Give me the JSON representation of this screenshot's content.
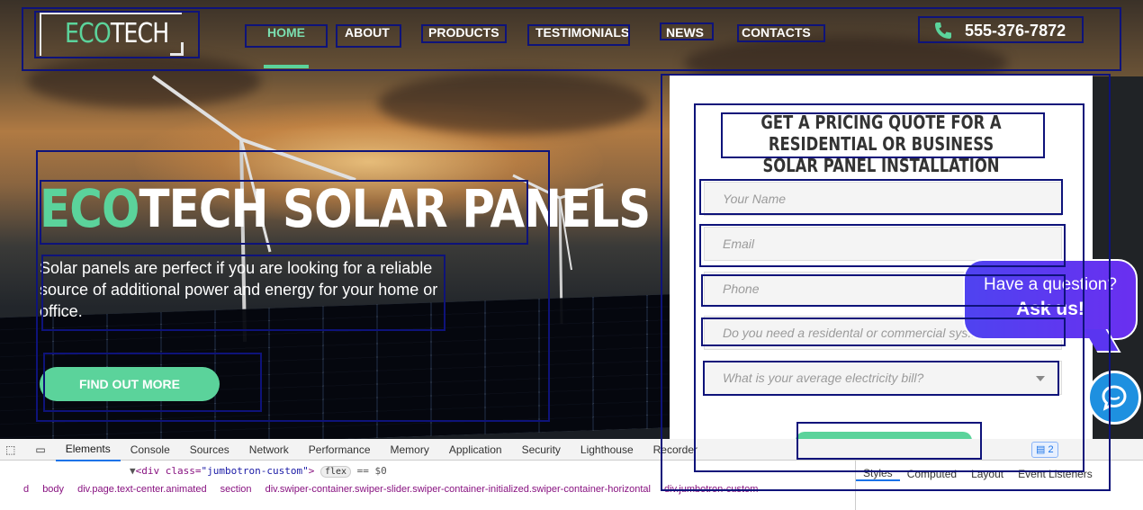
{
  "brand": {
    "eco": "ECO",
    "tech": "TECH"
  },
  "nav": {
    "items": [
      {
        "label": "HOME",
        "active": true
      },
      {
        "label": "ABOUT"
      },
      {
        "label": "PRODUCTS"
      },
      {
        "label": "TESTIMONIALS"
      },
      {
        "label": "NEWS"
      },
      {
        "label": "CONTACTS"
      }
    ],
    "phone": "555-376-7872"
  },
  "hero": {
    "title_eco": "ECO",
    "title_rest": "TECH SOLAR PANELS",
    "description": "Solar panels are perfect if you are looking for a reliable source of additional power and energy for your home or office.",
    "cta_label": "FIND OUT MORE"
  },
  "form": {
    "title": "GET A PRICING QUOTE FOR A RESIDENTIAL OR BUSINESS SOLAR PANEL INSTALLATION",
    "name_placeholder": "Your Name",
    "email_placeholder": "Email",
    "phone_placeholder": "Phone",
    "type_placeholder": "Do you need a residental or commercial sys...",
    "bill_placeholder": "What is your average electricity bill?"
  },
  "chat": {
    "line1": "Have a question?",
    "line2": "Ask us!"
  },
  "devtools": {
    "tabs": [
      "Elements",
      "Console",
      "Sources",
      "Network",
      "Performance",
      "Memory",
      "Application",
      "Security",
      "Lighthouse",
      "Recorder"
    ],
    "issues_count": "2",
    "code_tag": "<div class=",
    "code_class": "\"jumbotron-custom\"",
    "code_close": ">",
    "code_pill": "flex",
    "code_eq": "== $0",
    "crumbs": [
      "d",
      "body",
      "div.page.text-center.animated",
      "section",
      "div.swiper-container.swiper-slider.swiper-container-initialized.swiper-container-horizontal",
      "div.jumbotron-custom"
    ],
    "side_tabs": [
      "Styles",
      "Computed",
      "Layout",
      "Event Listeners"
    ]
  },
  "colors": {
    "accent": "#5bd39b",
    "chat": "#5a35f0",
    "outline": "#0e137a"
  }
}
